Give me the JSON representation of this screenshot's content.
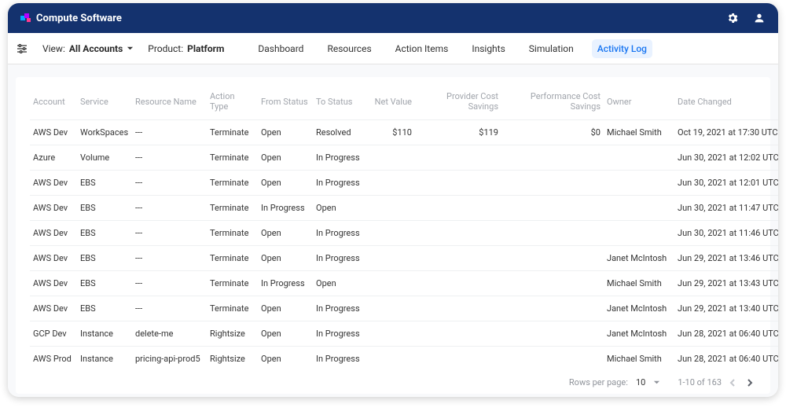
{
  "brand": {
    "name": "Compute Software"
  },
  "nav": {
    "view_label": "View:",
    "view_value": "All Accounts",
    "product_label": "Product:",
    "product_value": "Platform",
    "tabs": [
      {
        "label": "Dashboard",
        "active": false
      },
      {
        "label": "Resources",
        "active": false
      },
      {
        "label": "Action Items",
        "active": false
      },
      {
        "label": "Insights",
        "active": false
      },
      {
        "label": "Simulation",
        "active": false
      },
      {
        "label": "Activity Log",
        "active": true
      }
    ]
  },
  "table": {
    "columns": [
      "Account",
      "Service",
      "Resource Name",
      "Action Type",
      "From Status",
      "To Status",
      "Net Value",
      "Provider Cost Savings",
      "Performance Cost Savings",
      "Owner",
      "Date Changed"
    ],
    "rows": [
      {
        "account": "AWS Dev",
        "service": "WorkSpaces",
        "resource": "---",
        "action": "Terminate",
        "from": "Open",
        "to": "Resolved",
        "net": "$110",
        "provider": "$119",
        "perf": "$0",
        "owner": "Michael Smith",
        "date": "Oct 19, 2021 at 17:30 UTC"
      },
      {
        "account": "Azure",
        "service": "Volume",
        "resource": "---",
        "action": "Terminate",
        "from": "Open",
        "to": "In Progress",
        "net": "",
        "provider": "",
        "perf": "",
        "owner": "",
        "date": "Jun 30, 2021 at 12:02 UTC"
      },
      {
        "account": "AWS Dev",
        "service": "EBS",
        "resource": "---",
        "action": "Terminate",
        "from": "Open",
        "to": "In Progress",
        "net": "",
        "provider": "",
        "perf": "",
        "owner": "",
        "date": "Jun 30, 2021 at 12:01 UTC"
      },
      {
        "account": "AWS Dev",
        "service": "EBS",
        "resource": "---",
        "action": "Terminate",
        "from": "In Progress",
        "to": "Open",
        "net": "",
        "provider": "",
        "perf": "",
        "owner": "",
        "date": "Jun 30, 2021 at 11:47 UTC"
      },
      {
        "account": "AWS Dev",
        "service": "EBS",
        "resource": "---",
        "action": "Terminate",
        "from": "Open",
        "to": "In Progress",
        "net": "",
        "provider": "",
        "perf": "",
        "owner": "",
        "date": "Jun 30, 2021 at 11:46 UTC"
      },
      {
        "account": "AWS Dev",
        "service": "EBS",
        "resource": "---",
        "action": "Terminate",
        "from": "Open",
        "to": "In Progress",
        "net": "",
        "provider": "",
        "perf": "",
        "owner": "Janet McIntosh",
        "date": "Jun 29, 2021 at 13:46 UTC"
      },
      {
        "account": "AWS Dev",
        "service": "EBS",
        "resource": "---",
        "action": "Terminate",
        "from": "In Progress",
        "to": "Open",
        "net": "",
        "provider": "",
        "perf": "",
        "owner": "Michael Smith",
        "date": "Jun 29, 2021 at 13:43 UTC"
      },
      {
        "account": "AWS Dev",
        "service": "EBS",
        "resource": "---",
        "action": "Terminate",
        "from": "Open",
        "to": "In Progress",
        "net": "",
        "provider": "",
        "perf": "",
        "owner": "Janet McIntosh",
        "date": "Jun 29, 2021 at 13:40 UTC"
      },
      {
        "account": "GCP Dev",
        "service": "Instance",
        "resource": "delete-me",
        "action": "Rightsize",
        "from": "Open",
        "to": "In Progress",
        "net": "",
        "provider": "",
        "perf": "",
        "owner": "Janet McIntosh",
        "date": "Jun 28, 2021 at 06:40 UTC"
      },
      {
        "account": "AWS Prod",
        "service": "Instance",
        "resource": "pricing-api-prod5",
        "action": "Rightsize",
        "from": "Open",
        "to": "In Progress",
        "net": "",
        "provider": "",
        "perf": "",
        "owner": "Michael Smith",
        "date": "Jun 28, 2021 at 06:40 UTC"
      }
    ]
  },
  "pagination": {
    "rows_per_page_label": "Rows per page:",
    "rows_per_page_value": "10",
    "range_text": "1-10 of 163"
  }
}
